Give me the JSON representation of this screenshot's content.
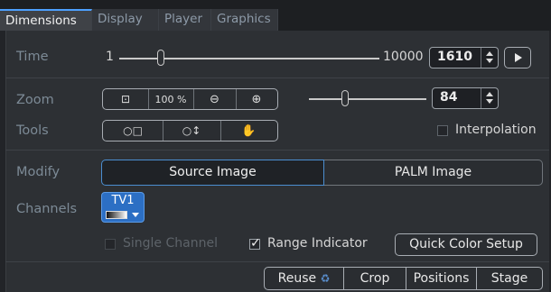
{
  "tabs": [
    "Dimensions",
    "Display",
    "Player",
    "Graphics"
  ],
  "time": {
    "label": "Time",
    "min": "1",
    "max": "10000",
    "value": "1610",
    "slider_fraction": 0.16
  },
  "zoom": {
    "label": "Zoom",
    "buttons": [
      "fit-icon",
      "100 %",
      "zoom-out-icon",
      "zoom-in-icon"
    ],
    "value": "84",
    "slider_fraction": 0.42
  },
  "tools": {
    "label": "Tools",
    "buttons": [
      "select-rect-icon",
      "select-move-icon",
      "pan-hand-icon"
    ]
  },
  "interpolation": {
    "label": "Interpolation",
    "checked": false
  },
  "modify": {
    "label": "Modify",
    "options": [
      "Source Image",
      "PALM Image"
    ],
    "selected": "Source Image"
  },
  "channels": {
    "label": "Channels",
    "tv": "TV1"
  },
  "single_channel": {
    "label": "Single Channel",
    "checked": false,
    "enabled": false
  },
  "range_indicator": {
    "label": "Range Indicator",
    "checked": true
  },
  "quick_color": {
    "label": "Quick Color Setup"
  },
  "bottom": {
    "reuse": "Reuse",
    "crop": "Crop",
    "positions": "Positions",
    "stage": "Stage"
  },
  "colors": {
    "accent": "#4da0ff",
    "background": "#2d3034"
  }
}
